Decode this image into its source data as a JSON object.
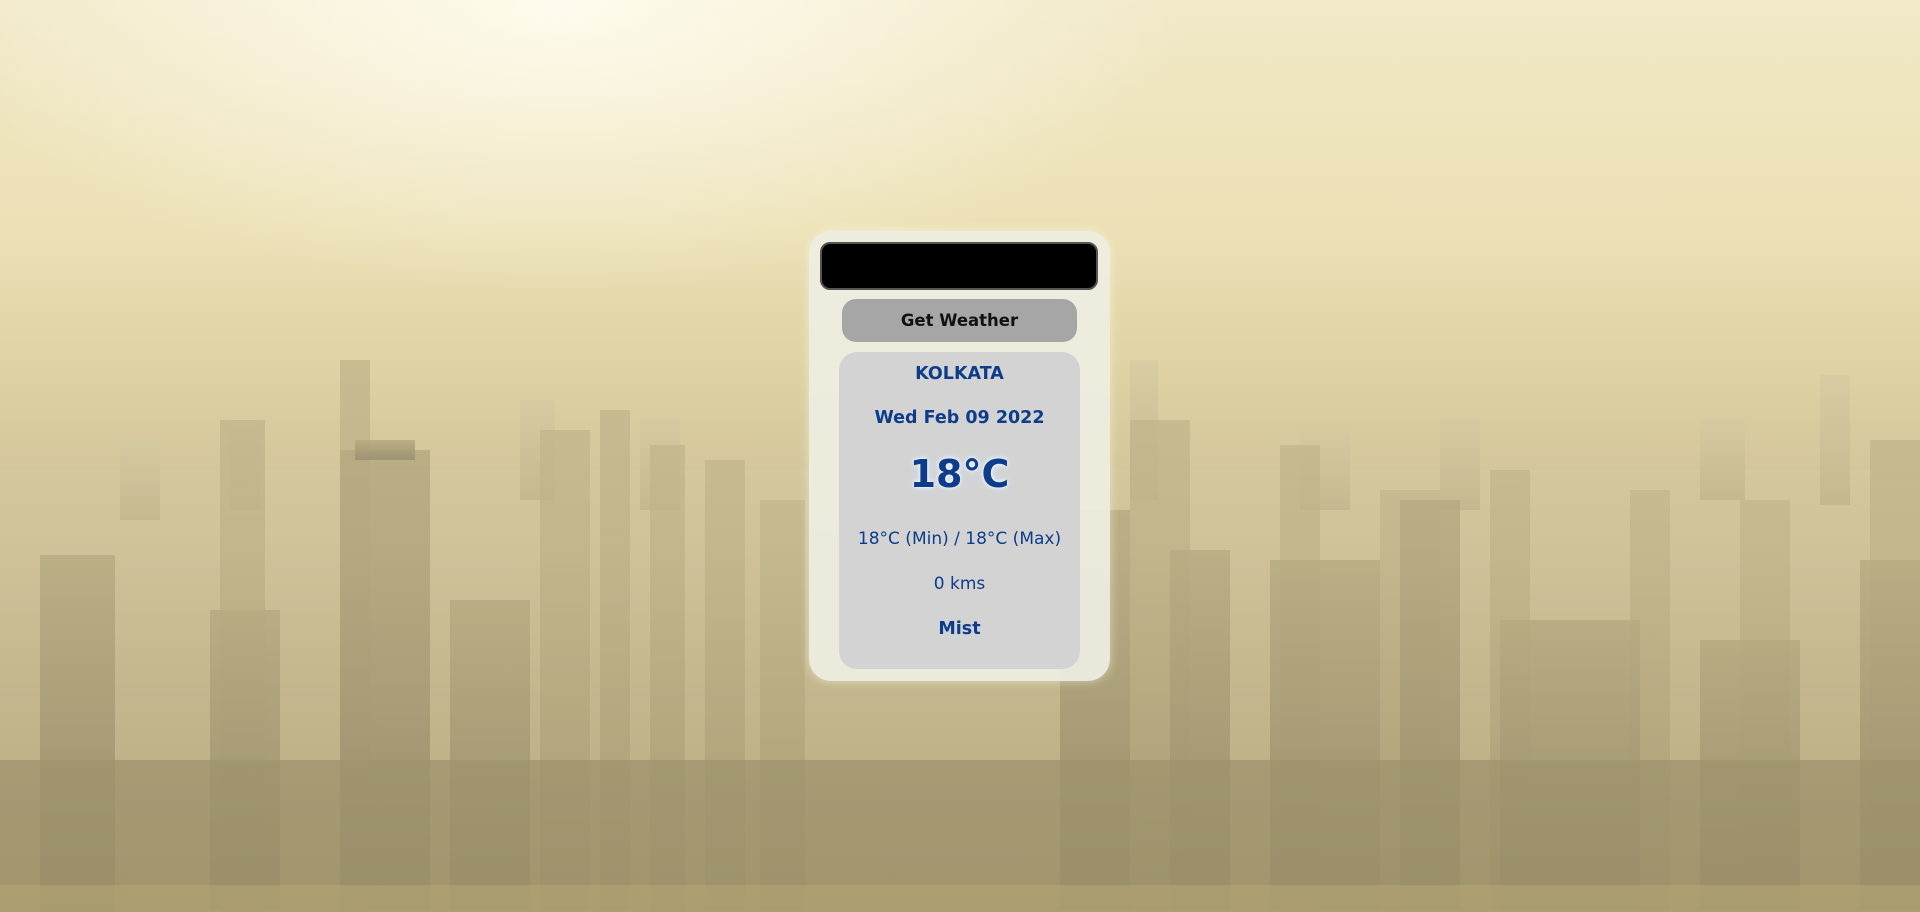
{
  "search": {
    "value": "",
    "placeholder": ""
  },
  "button": {
    "label": "Get Weather"
  },
  "weather": {
    "city": "KOLKATA",
    "date": "Wed Feb 09 2022",
    "temperature": "18°C",
    "min_max": "18°C (Min) / 18°C (Max)",
    "visibility": "0 kms",
    "description": "Mist"
  },
  "colors": {
    "text_accent": "#0d3d8a",
    "button_bg": "#a6a6a6",
    "input_bg": "#000000",
    "info_bg": "#d3d3d3"
  }
}
